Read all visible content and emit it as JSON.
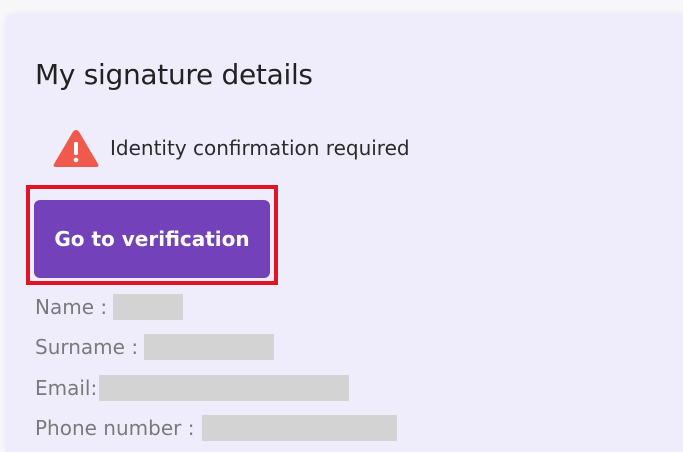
{
  "card": {
    "title": "My signature details",
    "warning": {
      "icon": "warning-icon",
      "text": "Identity confirmation required",
      "icon_color": "#f05a4d"
    },
    "verify_button": {
      "label": "Go to verification",
      "color": "#7342bb"
    },
    "fields": {
      "name_label": "Name :",
      "surname_label": "Surname :",
      "email_label": "Email:",
      "phone_label": "Phone number :"
    }
  },
  "colors": {
    "card_background": "#efedfb",
    "highlight_border": "#e01422",
    "redaction": "#d3d3d3"
  }
}
